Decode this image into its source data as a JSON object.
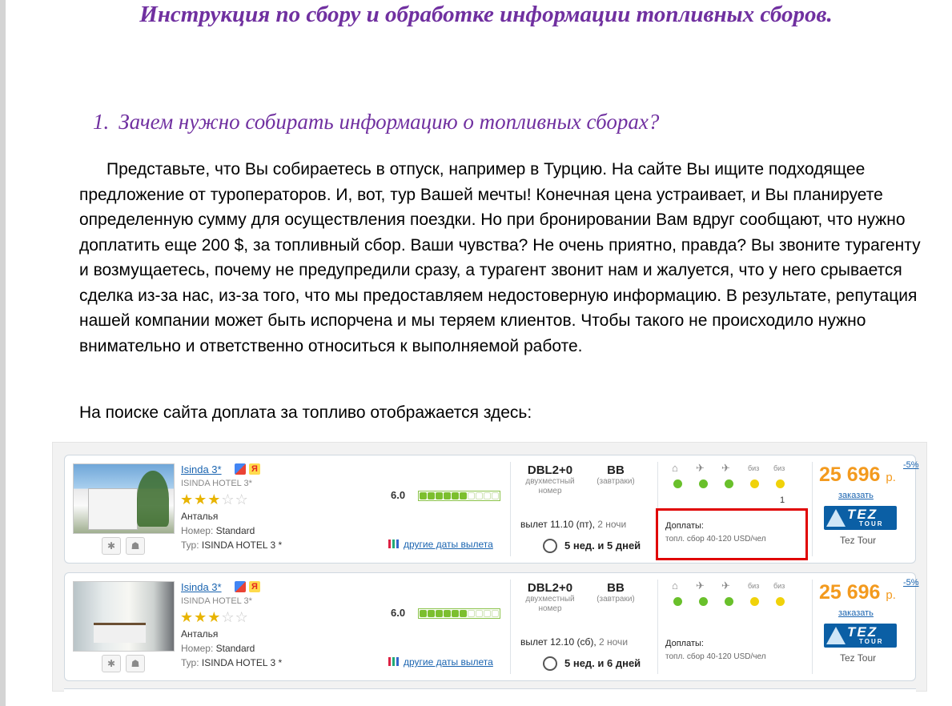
{
  "doc": {
    "title": "Инструкция по сбору и обработке информации топливных сборов.",
    "section_number": "1.",
    "section_heading": "Зачем нужно собирать информацию о топливных сборах?",
    "paragraph1": "Представьте, что Вы собираетесь в отпуск, например в Турцию.  На сайте Вы ищите подходящее предложение от туроператоров. И, вот, тур Вашей мечты! Конечная цена устраивает, и Вы планируете определенную сумму для осуществления поездки. Но при бронировании Вам вдруг сообщают, что нужно доплатить еще 200 $, за топливный сбор. Ваши чувства? Не очень приятно, правда? Вы звоните турагенту и возмущаетесь, почему не предупредили сразу, а турагент звонит нам и жалуется, что у него срывается сделка из-за нас, из-за того, что мы предоставляем недостоверную информацию. В результате, репутация нашей компании может быть испорчена и мы теряем клиентов. Чтобы такого не происходило нужно внимательно и ответственно относиться к выполняемой работе.",
    "paragraph2": "На поиске сайта доплата за топливо отображается здесь:"
  },
  "results": [
    {
      "hotel_name": "Isinda 3*",
      "yandex_badge": "Я",
      "hotel_subname": "ISINDA HOTEL 3*",
      "stars_filled": 3,
      "stars_total": 5,
      "city": "Анталья",
      "room_key": "Номер:",
      "room_value": "Standard",
      "tour_key": "Тур:",
      "tour_value": "ISINDA HOTEL 3 *",
      "rating": "6.0",
      "rating_fraction": 0.6,
      "other_dates": "другие даты вылета",
      "room_code": "DBL2+0",
      "room_desc1": "двухместный",
      "room_desc2": "номер",
      "meal_code": "BB",
      "meal_desc": "(завтраки)",
      "departure": "вылет 11.10 (пт),",
      "nights": "2 ночи",
      "duration": "5 нед. и 5 дней",
      "service_icons": [
        "home-icon",
        "flight-icon",
        "flight-return-icon",
        "biz",
        "biz"
      ],
      "service_status": [
        "green",
        "green",
        "green",
        "yellow",
        "yellow"
      ],
      "service_count": "1",
      "surcharges_label": "Доплаты:",
      "surcharges_text": "топл. сбор 40-120 USD/чел",
      "price": "25 696",
      "currency": "р.",
      "discount": "-5%",
      "order": "заказать",
      "operator_logo": "TEZ",
      "operator_logo_sub": "TOUR",
      "operator": "Tez Tour",
      "highlighted": true
    },
    {
      "hotel_name": "Isinda 3*",
      "yandex_badge": "Я",
      "hotel_subname": "ISINDA HOTEL 3*",
      "stars_filled": 3,
      "stars_total": 5,
      "city": "Анталья",
      "room_key": "Номер:",
      "room_value": "Standard",
      "tour_key": "Тур:",
      "tour_value": "ISINDA HOTEL 3 *",
      "rating": "6.0",
      "rating_fraction": 0.6,
      "other_dates": "другие даты вылета",
      "room_code": "DBL2+0",
      "room_desc1": "двухместный",
      "room_desc2": "номер",
      "meal_code": "BB",
      "meal_desc": "(завтраки)",
      "departure": "вылет 12.10 (сб),",
      "nights": "2 ночи",
      "duration": "5 нед. и 6 дней",
      "service_icons": [
        "home-icon",
        "flight-icon",
        "flight-return-icon",
        "biz",
        "biz"
      ],
      "service_status": [
        "green",
        "green",
        "green",
        "yellow",
        "yellow"
      ],
      "service_count": "",
      "surcharges_label": "Доплаты:",
      "surcharges_text": "топл. сбор 40-120 USD/чел",
      "price": "25 696",
      "currency": "р.",
      "discount": "-5%",
      "order": "заказать",
      "operator_logo": "TEZ",
      "operator_logo_sub": "TOUR",
      "operator": "Tez Tour",
      "highlighted": false
    }
  ],
  "colors": {
    "heading": "#7030a0",
    "link": "#1a64b0",
    "price": "#f39a1e",
    "highlight": "#e00000",
    "status_green": "#69c02b",
    "status_yellow": "#f0d20a"
  }
}
